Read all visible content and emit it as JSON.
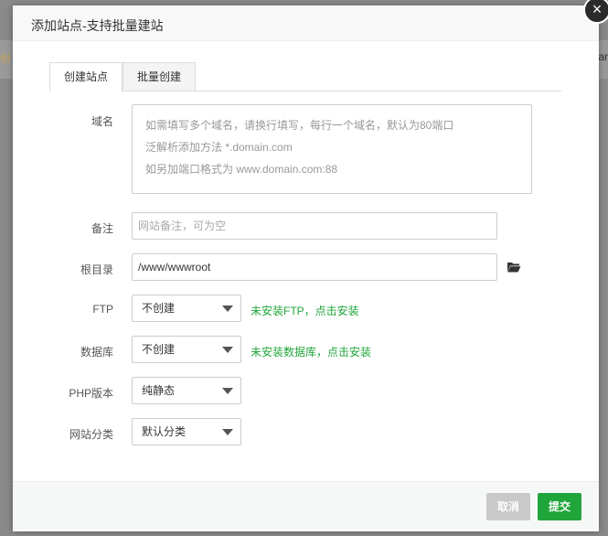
{
  "background": {
    "left_text": "份",
    "right_text": "ar"
  },
  "dialog": {
    "title": "添加站点-支持批量建站"
  },
  "tabs": [
    {
      "label": "创建站点",
      "active": true
    },
    {
      "label": "批量创建",
      "active": false
    }
  ],
  "form": {
    "domain": {
      "label": "域名",
      "placeholder_lines": [
        "如需填写多个域名，请换行填写，每行一个域名，默认为80端口",
        "泛解析添加方法 *.domain.com",
        "如另加端口格式为 www.domain.com:88"
      ]
    },
    "note": {
      "label": "备注",
      "placeholder": "网站备注，可为空"
    },
    "root_dir": {
      "label": "根目录",
      "value": "/www/wwwroot"
    },
    "ftp": {
      "label": "FTP",
      "selected": "不创建",
      "hint": "未安装FTP，点击安装"
    },
    "database": {
      "label": "数据库",
      "selected": "不创建",
      "hint": "未安装数据库，点击安装"
    },
    "php_version": {
      "label": "PHP版本",
      "selected": "纯静态"
    },
    "site_category": {
      "label": "网站分类",
      "selected": "默认分类"
    }
  },
  "footer": {
    "cancel_label": "取消",
    "submit_label": "提交"
  },
  "colors": {
    "accent": "#20a53a",
    "cancel": "#c9c9c9"
  }
}
